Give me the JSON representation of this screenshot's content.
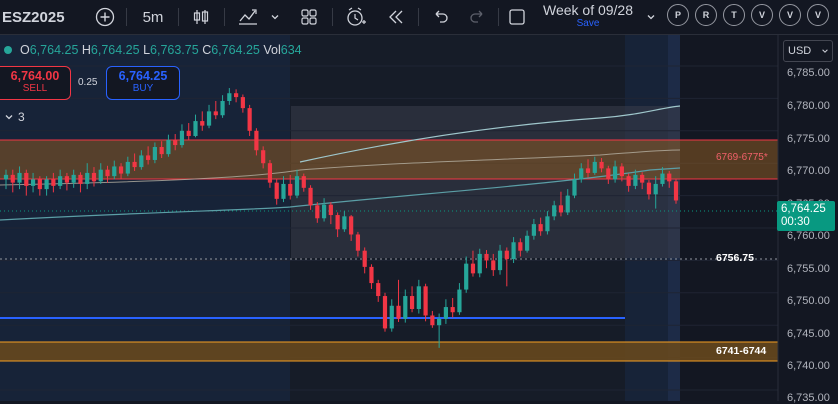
{
  "toolbar": {
    "symbol": "ESZ2025",
    "interval": "5m",
    "week_title": "Week of 09/28",
    "week_save": "Save",
    "circle_buttons": [
      "P",
      "R",
      "T",
      "V",
      "V",
      "V"
    ]
  },
  "legend": {
    "o_label": "O",
    "o_value": "6,764.25",
    "h_label": "H",
    "h_value": "6,764.25",
    "l_label": "L",
    "l_value": "6,763.75",
    "c_label": "C",
    "c_value": "6,764.25",
    "vol_label": "Vol",
    "vol_value": "634"
  },
  "trade": {
    "sell_price": "6,764.00",
    "sell_label": "SELL",
    "spread": "0.25",
    "buy_price": "6,764.25",
    "buy_label": "BUY"
  },
  "indicators_toggle": {
    "count": "3"
  },
  "price_axis": {
    "currency": "USD",
    "ticks": [
      "6,785.00",
      "6,780.00",
      "6,775.00",
      "6,770.00",
      "6,765.00",
      "6,760.00",
      "6,755.00",
      "6,750.00",
      "6,745.00",
      "6,740.00",
      "6,735.00"
    ]
  },
  "current_price": {
    "price": "6,764.25",
    "countdown": "00:30"
  },
  "levels": {
    "zone_label": "6769-6775*",
    "level_1": "6756.75",
    "zone_2_label": "6741-6744"
  },
  "colors": {
    "up": "#26a69a",
    "down": "#f23645",
    "accent": "#2962ff",
    "zone_red": "#f23645",
    "zone_orange": "#f59f23"
  }
}
